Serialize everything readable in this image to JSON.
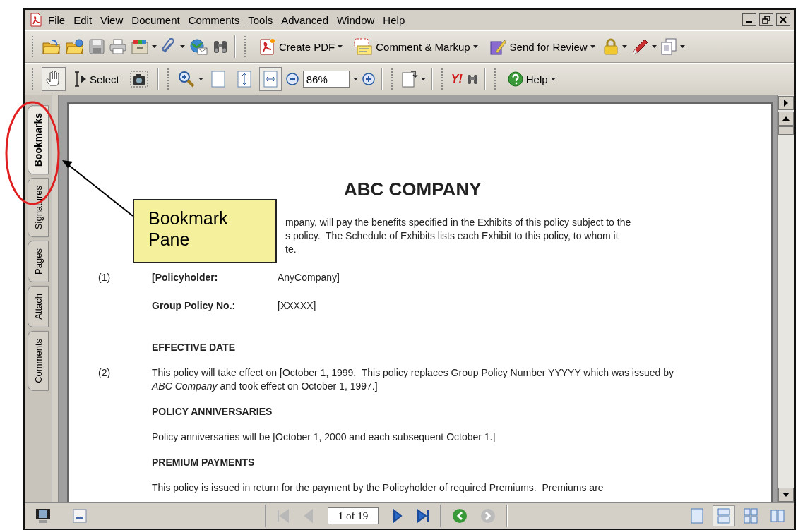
{
  "window": {
    "menu": [
      "File",
      "Edit",
      "View",
      "Document",
      "Comments",
      "Tools",
      "Advanced",
      "Window",
      "Help"
    ]
  },
  "file_toolbar": {
    "buttons": [
      {
        "label": "Create PDF"
      },
      {
        "label": "Comment & Markup"
      },
      {
        "label": "Send for Review"
      }
    ]
  },
  "view_toolbar": {
    "tools": [
      {
        "selected": true
      },
      {
        "label": "Select",
        "selected": false
      },
      {
        "selected": false
      }
    ],
    "page_views": [
      {
        "selected": false
      },
      {
        "selected": false
      },
      {
        "selected": true
      }
    ],
    "zoom_value": "86%",
    "logo_text": "Y!",
    "help_label": "Help"
  },
  "nav_tabs": [
    {
      "label": "Bookmarks",
      "selected": true
    },
    {
      "label": "Signatures",
      "selected": false
    },
    {
      "label": "Pages",
      "selected": false
    },
    {
      "label": "Attach",
      "selected": false
    },
    {
      "label": "Comments",
      "selected": false
    }
  ],
  "document": {
    "title": "ABC COMPANY",
    "intro_lines": [
      "mpany, will pay the benefits specified in the Exhibits of this policy subject to the",
      "s policy.  The Schedule of Exhibits lists each Exhibit to this policy, to whom it",
      "te."
    ],
    "fields": [
      {
        "number": "(1)",
        "label": "[Policyholder:",
        "value": "AnyCompany]"
      },
      {
        "label": "Group Policy No.:",
        "value": "[XXXXX]"
      }
    ],
    "sections": [
      {
        "heading": "EFFECTIVE DATE",
        "number": "(2)",
        "text": "This policy will take effect on [October 1, 1999.  This policy replaces Group Policy Number YYYYY which was issued by *ABC Company* and took effect on October 1, 1997.]"
      },
      {
        "heading": "POLICY ANNIVERSARIES",
        "text": "Policy anniversaries will be [October 1, 2000 and each subsequent October 1.]"
      },
      {
        "heading": "PREMIUM PAYMENTS",
        "text": "This policy is issued in return for the payment by the Policyholder of required Premiums.  Premiums are"
      }
    ]
  },
  "annotation": {
    "callout": "Bookmark Pane"
  },
  "status_bar": {
    "nav": [
      {
        "disabled": true
      },
      {
        "disabled": true
      },
      {
        "disabled": false
      },
      {
        "disabled": false
      }
    ],
    "page_field": "1 of 19",
    "history": [
      {
        "disabled": false
      },
      {
        "disabled": true
      }
    ],
    "layouts": [
      {
        "selected": false
      },
      {
        "selected": true
      },
      {
        "selected": false
      },
      {
        "selected": false
      }
    ]
  }
}
